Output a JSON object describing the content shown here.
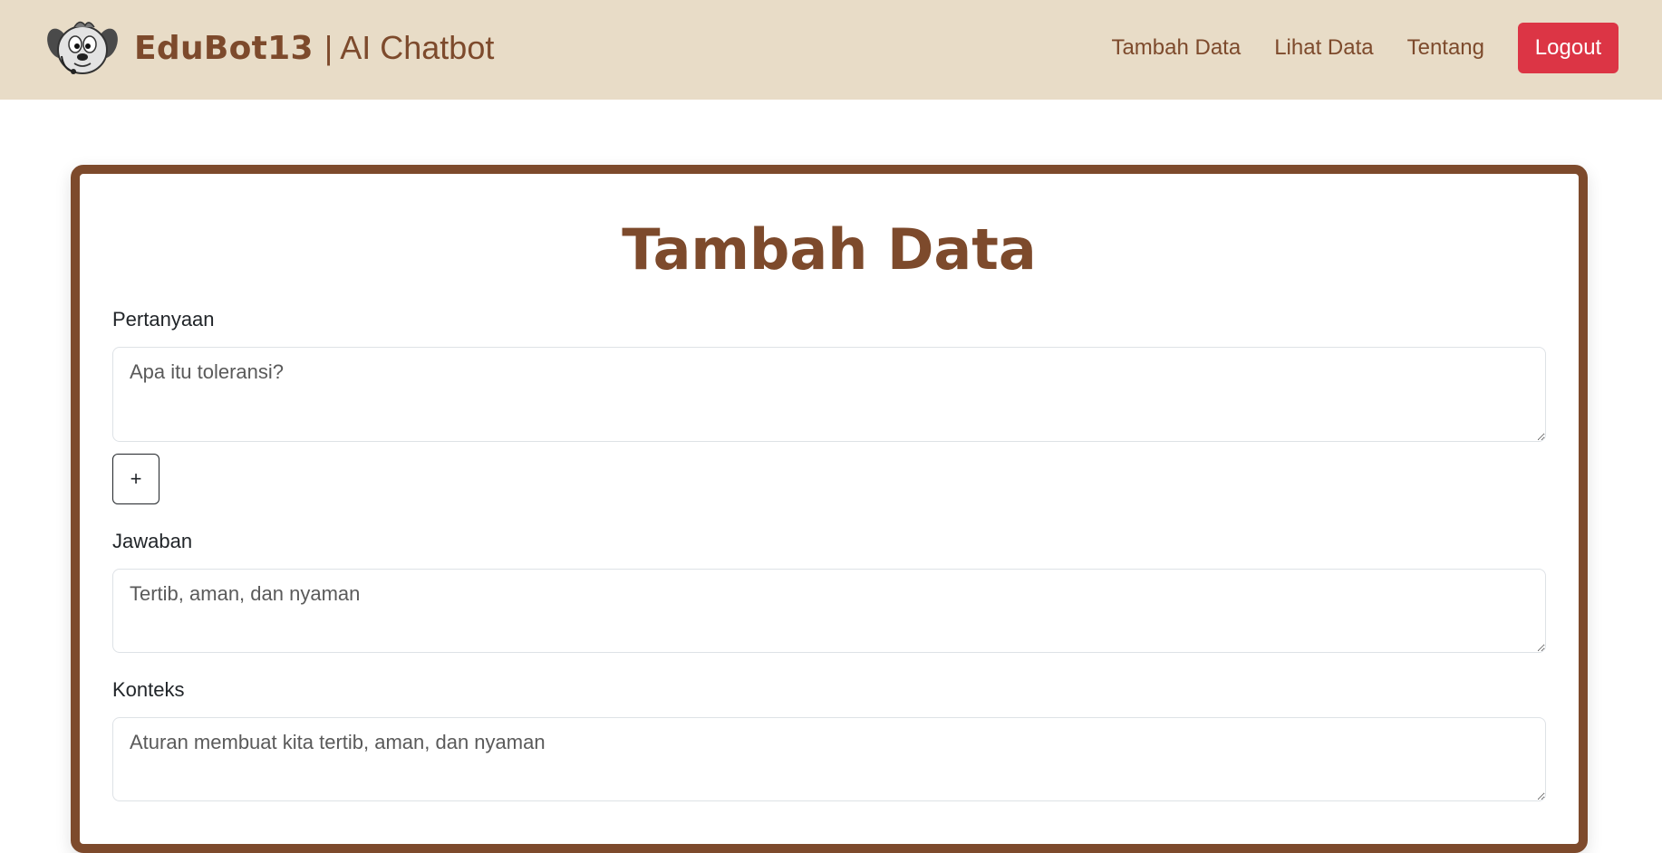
{
  "navbar": {
    "brand_name": "EduBot13",
    "brand_subtitle": "| AI Chatbot",
    "logo_icon": "cartoon-dog-mascot-icon",
    "links": [
      {
        "label": "Tambah Data"
      },
      {
        "label": "Lihat Data"
      },
      {
        "label": "Tentang"
      }
    ],
    "logout_label": "Logout"
  },
  "form": {
    "title": "Tambah Data",
    "pertanyaan": {
      "label": "Pertanyaan",
      "value": "Apa itu toleransi?"
    },
    "add_button_label": "+",
    "jawaban": {
      "label": "Jawaban",
      "value": "Tertib, aman, dan nyaman"
    },
    "konteks": {
      "label": "Konteks",
      "value": "Aturan membuat kita tertib, aman, dan nyaman"
    }
  },
  "colors": {
    "navbar_bg": "#e8dcc7",
    "brand_brown": "#7d4a2c",
    "logout_red": "#dc3545"
  }
}
